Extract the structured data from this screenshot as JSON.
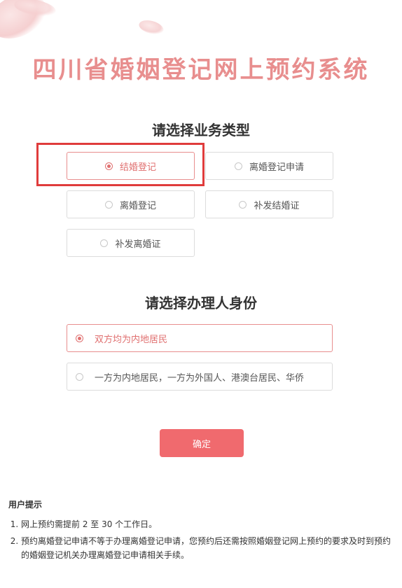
{
  "page": {
    "title": "四川省婚姻登记网上预约系统"
  },
  "business_type": {
    "heading": "请选择业务类型",
    "options": [
      {
        "label": "结婚登记",
        "selected": true
      },
      {
        "label": "离婚登记申请",
        "selected": false
      },
      {
        "label": "离婚登记",
        "selected": false
      },
      {
        "label": "补发结婚证",
        "selected": false
      },
      {
        "label": "补发离婚证",
        "selected": false
      }
    ]
  },
  "identity": {
    "heading": "请选择办理人身份",
    "options": [
      {
        "label": "双方均为内地居民",
        "selected": true
      },
      {
        "label": "一方为内地居民，一方为外国人、港澳台居民、华侨",
        "selected": false
      }
    ]
  },
  "actions": {
    "confirm_label": "确定"
  },
  "tips": {
    "title": "用户提示",
    "items": [
      "网上预约需提前 2 至 30 个工作日。",
      "预约离婚登记申请不等于办理离婚登记申请，您预约后还需按照婚姻登记网上预约的要求及时到预约的婚姻登记机关办理离婚登记申请相关手续。"
    ]
  },
  "colors": {
    "title": "#e88e8e",
    "accent": "#e07070",
    "button": "#f06a6e",
    "highlight": "#e03c3c"
  }
}
